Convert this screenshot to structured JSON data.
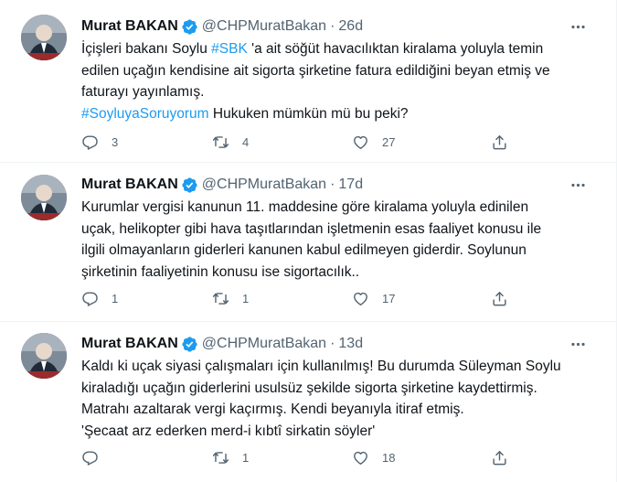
{
  "tweets": [
    {
      "name": "Murat BAKAN",
      "handle": "@CHPMuratBakan",
      "dot": "·",
      "time": "26d",
      "lines": [
        [
          {
            "t": "İçişleri bakanı Soylu "
          },
          {
            "t": "#SBK",
            "link": true
          },
          {
            "t": " 'a ait söğüt havacılıktan kiralama yoluyla temin"
          }
        ],
        [
          {
            "t": "edilen uçağın kendisine ait sigorta şirketine fatura edildiğini beyan etmiş ve"
          }
        ],
        [
          {
            "t": "faturayı yayınlamış."
          }
        ],
        [
          {
            "t": "#SoyluyaSoruyorum",
            "link": true
          },
          {
            "t": " Hukuken mümkün mü bu peki?"
          }
        ]
      ],
      "replies": "3",
      "retweets": "4",
      "likes": "27"
    },
    {
      "name": "Murat BAKAN",
      "handle": "@CHPMuratBakan",
      "dot": "·",
      "time": "17d",
      "lines": [
        [
          {
            "t": "Kurumlar vergisi kanunun 11. maddesine göre kiralama yoluyla edinilen"
          }
        ],
        [
          {
            "t": "uçak, helikopter gibi hava taşıtlarından işletmenin esas faaliyet konusu ile"
          }
        ],
        [
          {
            "t": "ilgili olmayanların giderleri kanunen kabul edilmeyen giderdir. Soylunun"
          }
        ],
        [
          {
            "t": "şirketinin faaliyetinin konusu ise sigortacılık.."
          }
        ]
      ],
      "replies": "1",
      "retweets": "1",
      "likes": "17"
    },
    {
      "name": "Murat BAKAN",
      "handle": "@CHPMuratBakan",
      "dot": "·",
      "time": "13d",
      "lines": [
        [
          {
            "t": "Kaldı ki uçak siyasi çalışmaları için kullanılmış! Bu durumda Süleyman Soylu"
          }
        ],
        [
          {
            "t": "kiraladığı uçağın giderlerini usulsüz şekilde sigorta şirketine kaydettirmiş."
          }
        ],
        [
          {
            "t": "Matrahı azaltarak vergi kaçırmış. Kendi beyanıyla itiraf etmiş."
          }
        ],
        [
          {
            "t": "'Şecaat arz ederken merd-i kıbtî sirkatin söyler'"
          }
        ]
      ],
      "replies": "",
      "retweets": "1",
      "likes": "18"
    }
  ],
  "icons": {
    "more": "more-icon",
    "verified": "verified-badge-icon",
    "reply": "reply-icon",
    "retweet": "retweet-icon",
    "like": "like-icon",
    "share": "share-icon"
  },
  "colors": {
    "accent": "#1d9bf0",
    "text": "#0f1419",
    "muted": "#536471",
    "border": "#eff3f4"
  }
}
